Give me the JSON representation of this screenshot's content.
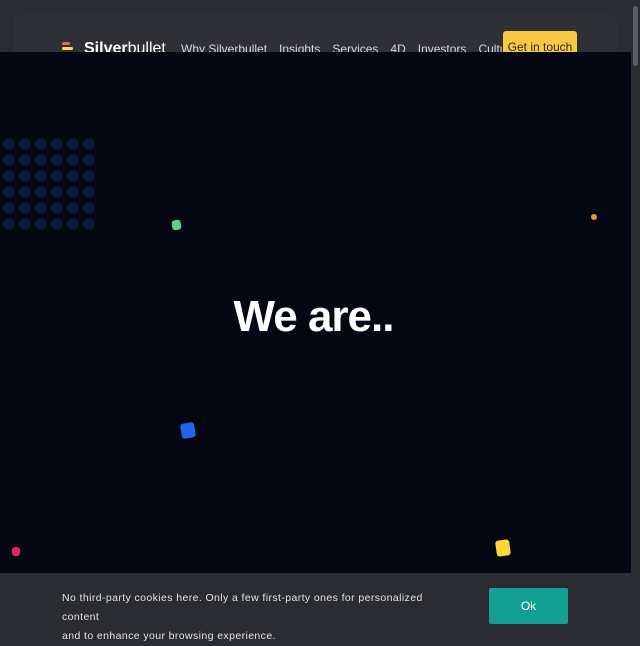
{
  "header": {
    "logo_bold": "Silver",
    "logo_regular": "bullet",
    "nav": [
      {
        "label": "Why Silverbullet"
      },
      {
        "label": "Insights"
      },
      {
        "label": "Services"
      },
      {
        "label": "4D"
      },
      {
        "label": "Investors"
      },
      {
        "label": "Culture"
      }
    ],
    "cta_label": "Get in touch",
    "cta_color": "#f8c845"
  },
  "hero": {
    "title": "We are..",
    "background": "#050812",
    "confetti_colors": [
      "#5ad28f",
      "#f2913a",
      "#2563eb",
      "#e0245e",
      "#ffd43b"
    ]
  },
  "cookie_banner": {
    "message_line1": "No third-party cookies here. Only a few first-party ones for personalized content",
    "message_line2": "and to enhance your browsing experience.",
    "ok_label": "Ok",
    "ok_color": "#149f95"
  }
}
